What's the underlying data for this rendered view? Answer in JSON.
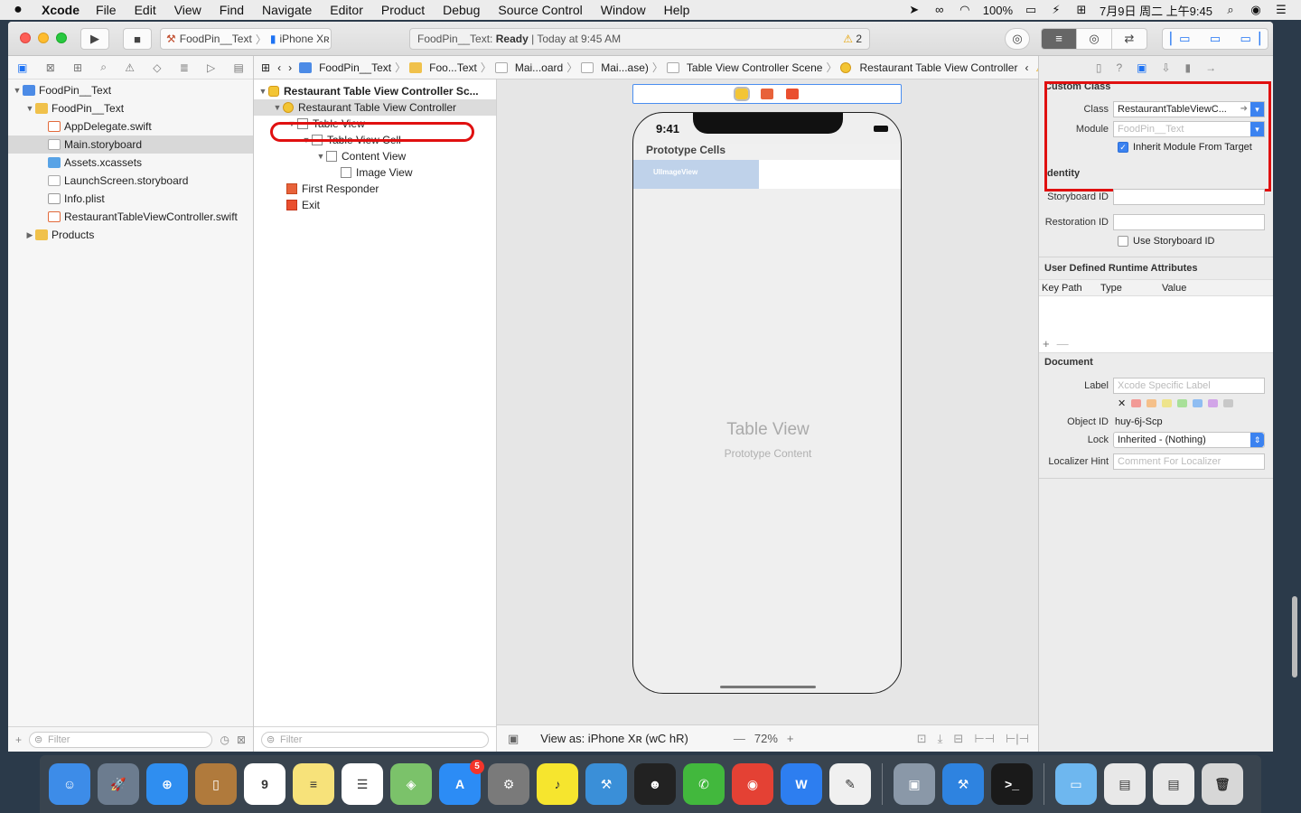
{
  "menubar": {
    "apple": "",
    "app_name": "Xcode",
    "items": [
      "File",
      "Edit",
      "View",
      "Find",
      "Navigate",
      "Editor",
      "Product",
      "Debug",
      "Source Control",
      "Window",
      "Help"
    ],
    "battery": "100%",
    "clock": "7月9日 周二 上午9:45",
    "icons": [
      "send-icon",
      "glasses-icon",
      "wifi-icon",
      "battery-icon",
      "power-icon",
      "input-method-icon",
      "search-icon",
      "siri-icon",
      "menu-list-icon"
    ]
  },
  "toolbar": {
    "scheme": "FoodPin__Text",
    "device": "iPhone Xʀ",
    "status_project": "FoodPin__Text:",
    "status_state": "Ready",
    "status_time": "| Today at 9:45 AM",
    "warnings": "2"
  },
  "navigator": {
    "tree": [
      {
        "label": "FoodPin__Text",
        "kind": "proj",
        "level": 0,
        "disclosure": "▼"
      },
      {
        "label": "FoodPin__Text",
        "kind": "folder",
        "level": 1,
        "disclosure": "▼"
      },
      {
        "label": "AppDelegate.swift",
        "kind": "swift",
        "level": 2
      },
      {
        "label": "Main.storyboard",
        "kind": "sb",
        "level": 2,
        "selected": true
      },
      {
        "label": "Assets.xcassets",
        "kind": "assets",
        "level": 2
      },
      {
        "label": "LaunchScreen.storyboard",
        "kind": "sb",
        "level": 2
      },
      {
        "label": "Info.plist",
        "kind": "plist",
        "level": 2
      },
      {
        "label": "RestaurantTableViewController.swift",
        "kind": "swift",
        "level": 2
      },
      {
        "label": "Products",
        "kind": "folder",
        "level": 1,
        "disclosure": "▶"
      }
    ],
    "filter_placeholder": "Filter"
  },
  "jumpbar": {
    "segments": [
      "FoodPin__Text",
      "Foo...Text",
      "Mai...oard",
      "Mai...ase)",
      "Table View Controller Scene",
      "Restaurant Table View Controller"
    ]
  },
  "outline": {
    "rows": [
      {
        "label": "Restaurant Table View Controller Sc...",
        "level": 0,
        "icon": "vc",
        "disclosure": "▼",
        "bold": true
      },
      {
        "label": "Restaurant Table View Controller",
        "level": 1,
        "icon": "vc",
        "disclosure": "▼",
        "highlight": true
      },
      {
        "label": "Table View",
        "level": 2,
        "icon": "view",
        "disclosure": "▼"
      },
      {
        "label": "Table View Cell",
        "level": 3,
        "icon": "view",
        "disclosure": "▼"
      },
      {
        "label": "Content View",
        "level": 4,
        "icon": "view",
        "disclosure": "▼"
      },
      {
        "label": "Image View",
        "level": 5,
        "icon": "view"
      },
      {
        "label": "First Responder",
        "level": 1,
        "icon": "resp"
      },
      {
        "label": "Exit",
        "level": 1,
        "icon": "exit"
      }
    ],
    "filter_placeholder": "Filter"
  },
  "canvas": {
    "time": "9:41",
    "prototype_cells": "Prototype Cells",
    "image_view_label": "UIImageView",
    "table_view_title": "Table View",
    "table_view_subtitle": "Prototype Content",
    "view_as": "View as: iPhone Xʀ (wC hR)",
    "zoom": "72%"
  },
  "inspector": {
    "custom_class_title": "Custom Class",
    "class_label": "Class",
    "class_value": "RestaurantTableViewC...",
    "module_label": "Module",
    "module_placeholder": "FoodPin__Text",
    "inherit_label": "Inherit Module From Target",
    "identity_title": "Identity",
    "storyboard_id_label": "Storyboard ID",
    "restoration_id_label": "Restoration ID",
    "use_storyboard_id_label": "Use Storyboard ID",
    "udra_title": "User Defined Runtime Attributes",
    "udra_cols": [
      "Key Path",
      "Type",
      "Value"
    ],
    "document_title": "Document",
    "label_label": "Label",
    "label_placeholder": "Xcode Specific Label",
    "object_id_label": "Object ID",
    "object_id_value": "huy-6j-Scp",
    "lock_label": "Lock",
    "lock_value": "Inherited - (Nothing)",
    "localizer_label": "Localizer Hint",
    "localizer_placeholder": "Comment For Localizer"
  },
  "dock": {
    "apps": [
      {
        "name": "finder",
        "color": "#3d8ce8",
        "glyph": "☺"
      },
      {
        "name": "launchpad",
        "color": "#6c7c8f",
        "glyph": "🚀"
      },
      {
        "name": "safari",
        "color": "#2f8ef0",
        "glyph": "⊕"
      },
      {
        "name": "contacts",
        "color": "#b07a3c",
        "glyph": "▯"
      },
      {
        "name": "calendar",
        "color": "#ffffff",
        "glyph": "9"
      },
      {
        "name": "notes",
        "color": "#f7e27a",
        "glyph": "≡"
      },
      {
        "name": "reminders",
        "color": "#ffffff",
        "glyph": "☰"
      },
      {
        "name": "maps",
        "color": "#7bc26a",
        "glyph": "◈"
      },
      {
        "name": "app-store",
        "color": "#2c8cf5",
        "glyph": "A",
        "badge": "5"
      },
      {
        "name": "system-preferences",
        "color": "#7a7a7a",
        "glyph": "⚙"
      },
      {
        "name": "music",
        "color": "#f6e52e",
        "glyph": "♪"
      },
      {
        "name": "xcode-instruments",
        "color": "#3a8fd8",
        "glyph": "⚒"
      },
      {
        "name": "qq",
        "color": "#222222",
        "glyph": "☻"
      },
      {
        "name": "wechat",
        "color": "#42b83d",
        "glyph": "✆"
      },
      {
        "name": "chrome",
        "color": "#e44134",
        "glyph": "◉"
      },
      {
        "name": "wps",
        "color": "#2d7ef0",
        "glyph": "W"
      },
      {
        "name": "textedit",
        "color": "#f0f0f0",
        "glyph": "✎"
      },
      {
        "name": "preview",
        "color": "#8a98a8",
        "glyph": "▣"
      },
      {
        "name": "xcode",
        "color": "#2e83e0",
        "glyph": "⚒"
      },
      {
        "name": "terminal",
        "color": "#1a1a1a",
        "glyph": ">_"
      },
      {
        "name": "downloads-folder",
        "color": "#6eb7ef",
        "glyph": "▭"
      },
      {
        "name": "screenshot-1",
        "color": "#e8e8e8",
        "glyph": "▤"
      },
      {
        "name": "screenshot-2",
        "color": "#e8e8e8",
        "glyph": "▤"
      },
      {
        "name": "trash",
        "color": "#d7d7d7",
        "glyph": "🗑"
      }
    ]
  }
}
